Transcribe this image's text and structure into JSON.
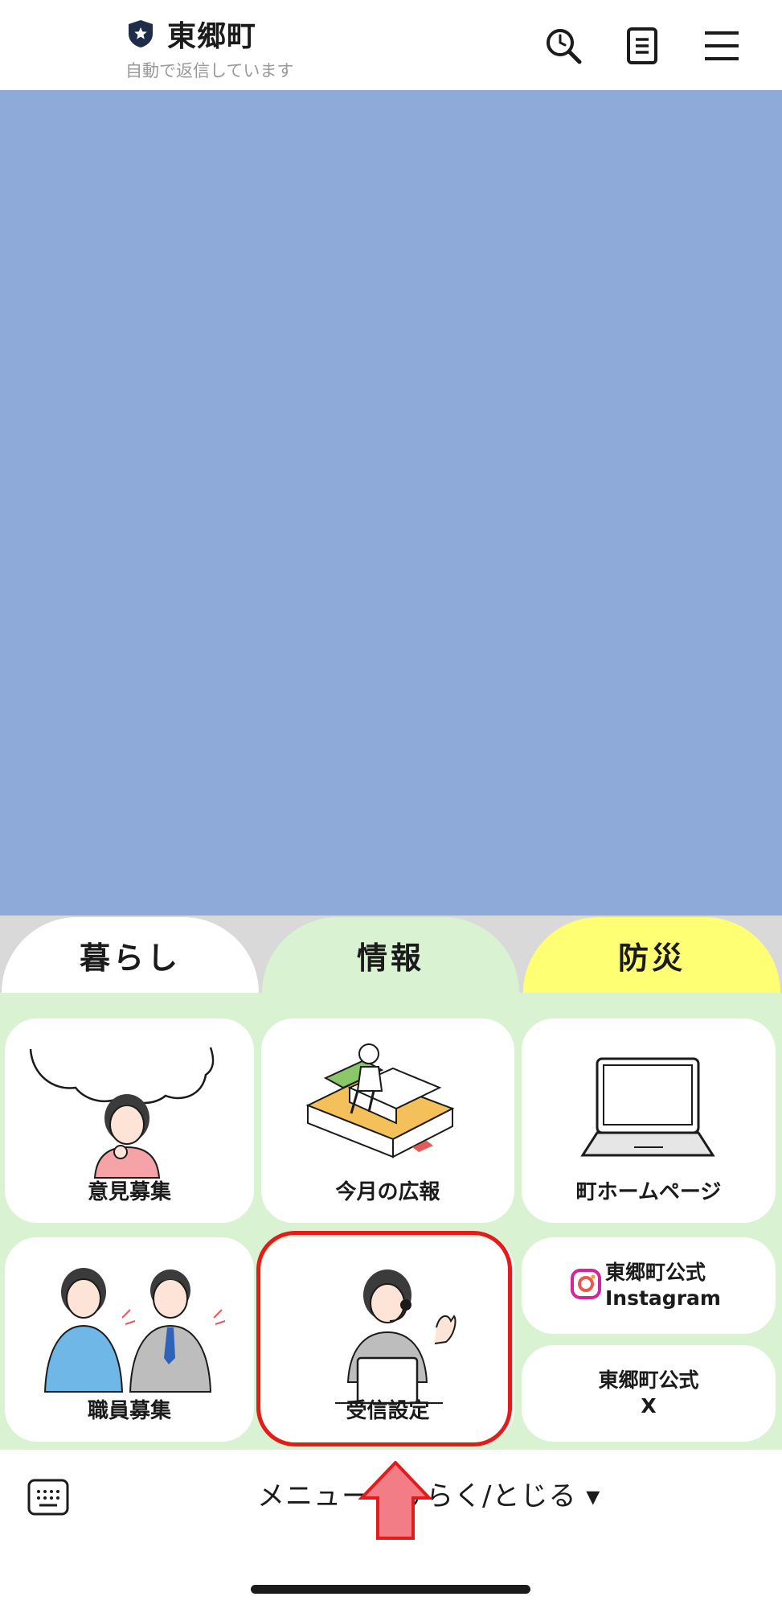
{
  "header": {
    "title": "東郷町",
    "subtitle": "自動で返信しています",
    "icons": [
      "shield-icon",
      "search-icon",
      "note-icon",
      "menu-icon"
    ]
  },
  "menu": {
    "tabs": [
      {
        "label": "暮らし",
        "color": "#ffffff"
      },
      {
        "label": "情報",
        "color": "#d9f2d1"
      },
      {
        "label": "防災",
        "color": "#ffff73"
      }
    ],
    "tiles": {
      "opinion": "意見募集",
      "koho": "今月の広報",
      "homepage": "町ホームページ",
      "instagram_line1": "東郷町公式",
      "instagram_line2": "Instagram",
      "staff": "職員募集",
      "receive": "受信設定",
      "x_line1": "東郷町公式",
      "x_line2": "X"
    }
  },
  "bottom": {
    "toggle_label": "メニューをひらく/とじる ▾"
  },
  "colors": {
    "chat_bg": "#8daad9",
    "menu_bg": "#d9f2d1",
    "highlight": "#e31b1b"
  }
}
